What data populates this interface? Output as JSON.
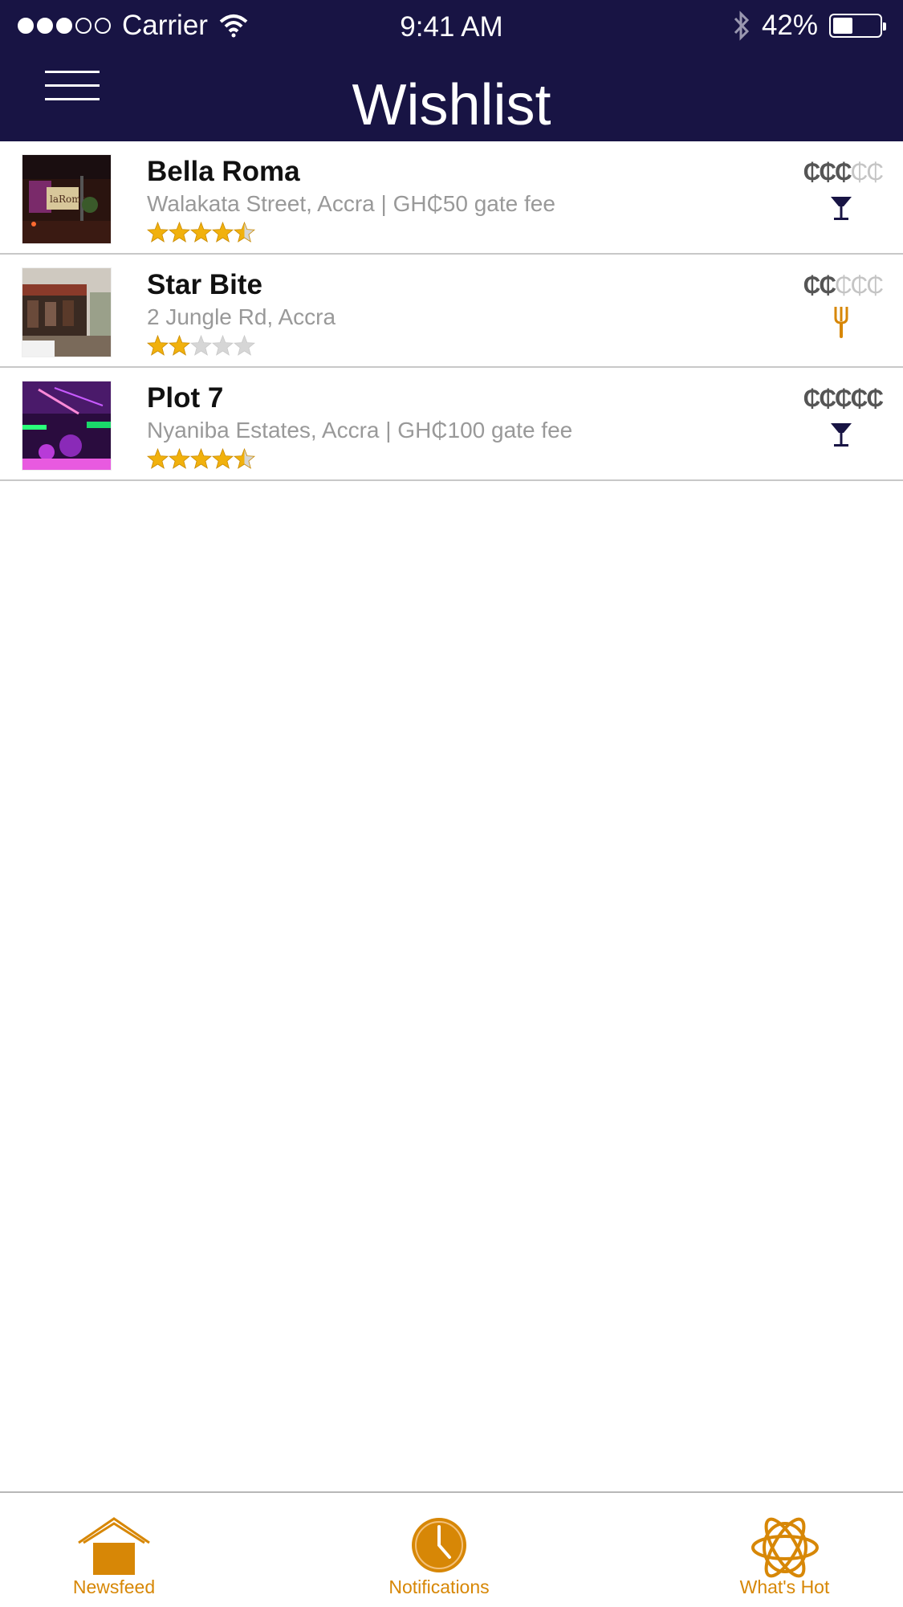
{
  "status_bar": {
    "carrier": "Carrier",
    "time": "9:41 AM",
    "battery_text": "42%",
    "battery_level": 0.42
  },
  "header": {
    "title": "Wishlist"
  },
  "colors": {
    "header_bg": "#181444",
    "accent": "#d78706",
    "star": "#f1b10d",
    "icon_dark": "#181444"
  },
  "wishlist": {
    "items": [
      {
        "name": "Bella Roma",
        "address": "Walakata Street, Accra | GH₵50 gate fee",
        "rating": 4.5,
        "price_level": 3,
        "price_max": 5,
        "category_icon": "cocktail-icon"
      },
      {
        "name": "Star Bite",
        "address": "2 Jungle Rd, Accra",
        "rating": 2,
        "price_level": 2,
        "price_max": 5,
        "category_icon": "fork-icon"
      },
      {
        "name": "Plot 7",
        "address": "Nyaniba Estates, Accra | GH₵100 gate fee",
        "rating": 4.5,
        "price_level": 5,
        "price_max": 5,
        "category_icon": "cocktail-icon"
      }
    ]
  },
  "tabbar": {
    "newsfeed": "Newsfeed",
    "notifications": "Notifications",
    "whats_hot": "What's Hot"
  }
}
